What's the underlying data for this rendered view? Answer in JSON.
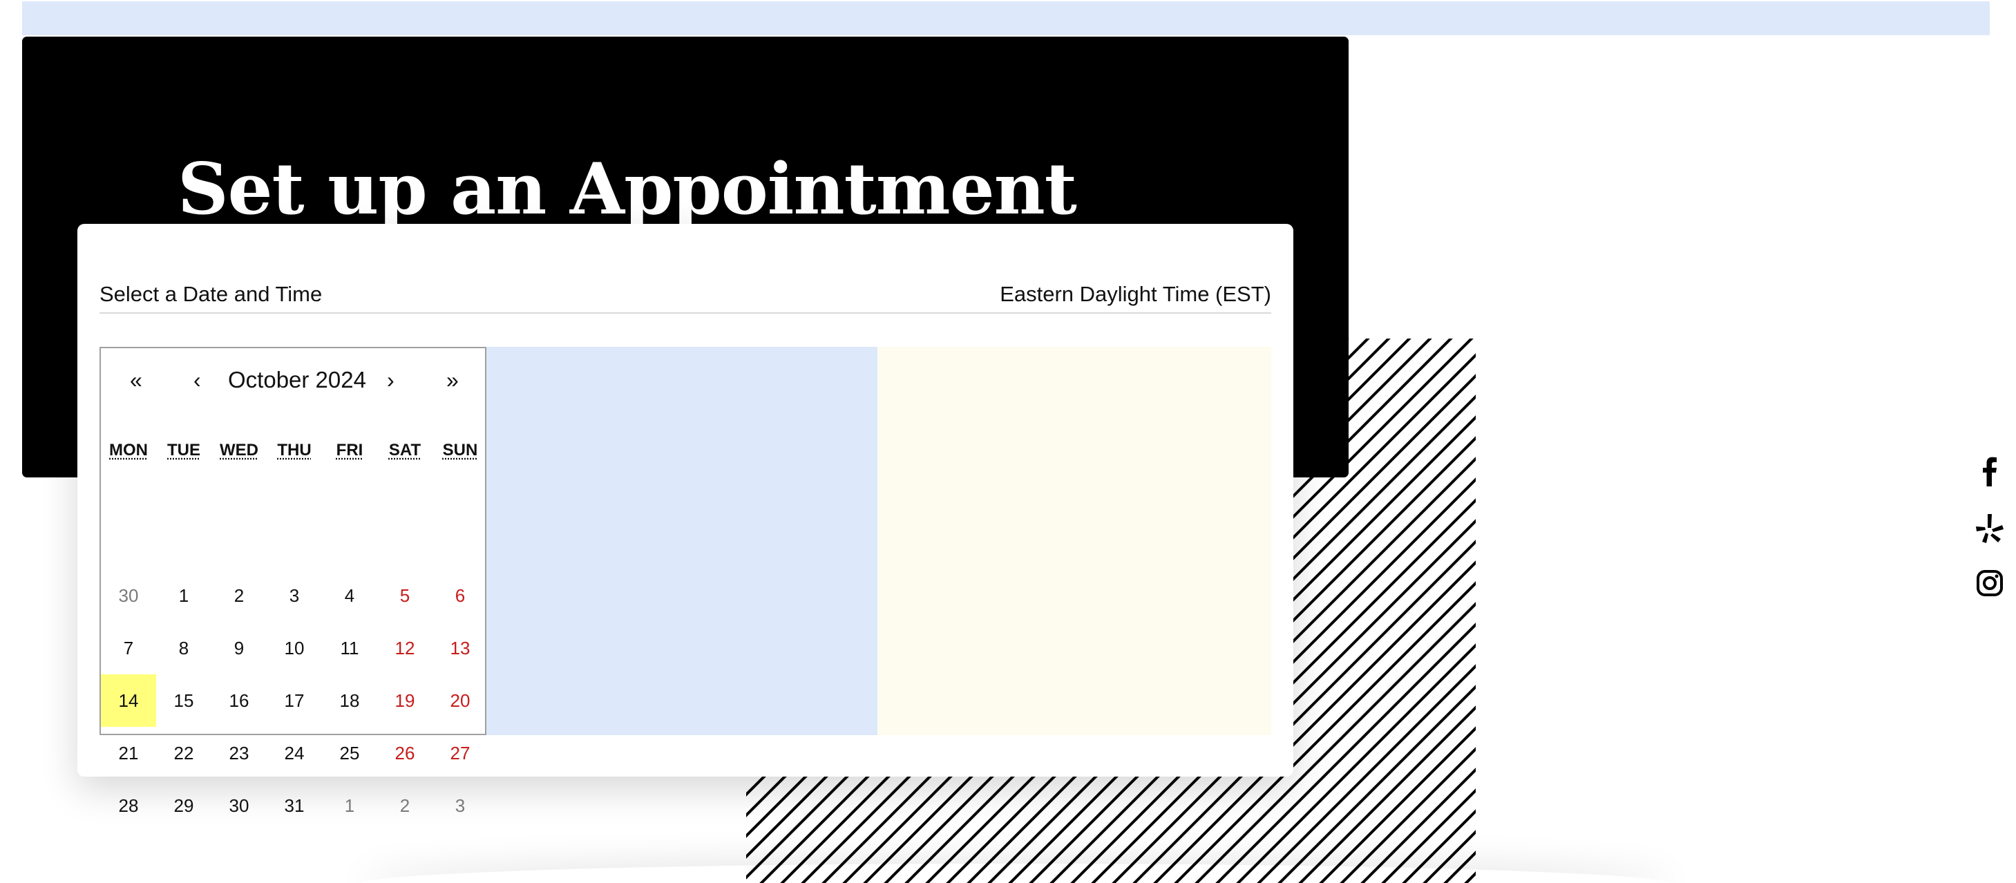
{
  "hero": {
    "title": "Set up an Appointment"
  },
  "scheduler": {
    "heading": "Select a Date and Time",
    "timezone": "Eastern Daylight Time (EST)"
  },
  "calendar": {
    "month_label": "October 2024",
    "nav": {
      "prev_year": "«",
      "prev_month": "‹",
      "next_month": "›",
      "next_year": "»"
    },
    "weekdays": [
      "MON",
      "TUE",
      "WED",
      "THU",
      "FRI",
      "SAT",
      "SUN"
    ],
    "weeks": [
      [
        {
          "day": "30",
          "state": "other"
        },
        {
          "day": "1",
          "state": "weekday"
        },
        {
          "day": "2",
          "state": "weekday"
        },
        {
          "day": "3",
          "state": "weekday"
        },
        {
          "day": "4",
          "state": "weekday"
        },
        {
          "day": "5",
          "state": "weekend"
        },
        {
          "day": "6",
          "state": "weekend"
        }
      ],
      [
        {
          "day": "7",
          "state": "weekday"
        },
        {
          "day": "8",
          "state": "weekday"
        },
        {
          "day": "9",
          "state": "weekday"
        },
        {
          "day": "10",
          "state": "weekday"
        },
        {
          "day": "11",
          "state": "weekday"
        },
        {
          "day": "12",
          "state": "weekend"
        },
        {
          "day": "13",
          "state": "weekend"
        }
      ],
      [
        {
          "day": "14",
          "state": "today"
        },
        {
          "day": "15",
          "state": "weekday"
        },
        {
          "day": "16",
          "state": "weekday"
        },
        {
          "day": "17",
          "state": "weekday"
        },
        {
          "day": "18",
          "state": "weekday"
        },
        {
          "day": "19",
          "state": "weekend"
        },
        {
          "day": "20",
          "state": "weekend"
        }
      ],
      [
        {
          "day": "21",
          "state": "weekday"
        },
        {
          "day": "22",
          "state": "weekday"
        },
        {
          "day": "23",
          "state": "weekday"
        },
        {
          "day": "24",
          "state": "weekday"
        },
        {
          "day": "25",
          "state": "weekday"
        },
        {
          "day": "26",
          "state": "weekend"
        },
        {
          "day": "27",
          "state": "weekend"
        }
      ],
      [
        {
          "day": "28",
          "state": "weekday"
        },
        {
          "day": "29",
          "state": "weekday"
        },
        {
          "day": "30",
          "state": "weekday"
        },
        {
          "day": "31",
          "state": "weekday"
        },
        {
          "day": "1",
          "state": "other"
        },
        {
          "day": "2",
          "state": "other"
        },
        {
          "day": "3",
          "state": "other"
        }
      ]
    ]
  },
  "social": {
    "icons": [
      "facebook-icon",
      "yelp-icon",
      "instagram-icon"
    ]
  },
  "colors": {
    "top_strip": "#dde8fa",
    "hero_bg": "#000000",
    "slots_pane": "#dde8fa",
    "detail_pane": "#fefcee",
    "today_highlight": "#ffff7c",
    "weekend_text": "#c81c1c",
    "other_month_text": "#7a7a7a"
  }
}
